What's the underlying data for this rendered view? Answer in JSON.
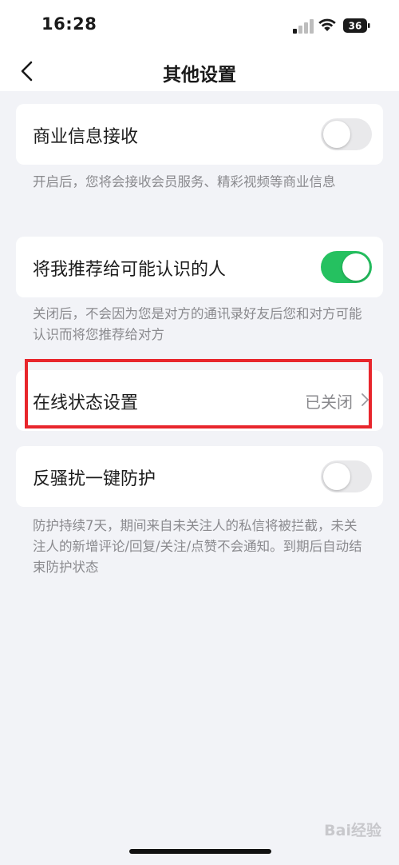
{
  "status_bar": {
    "time": "16:28",
    "battery_level": "36",
    "icons": [
      "signal-icon",
      "wifi-icon",
      "battery-icon"
    ]
  },
  "nav": {
    "title": "其他设置",
    "back_icon": "chevron-left-icon"
  },
  "settings": {
    "business_info": {
      "label": "商业信息接收",
      "enabled": false,
      "description": "开启后，您将会接收会员服务、精彩视频等商业信息"
    },
    "recommend": {
      "label": "将我推荐给可能认识的人",
      "enabled": true,
      "description": "关闭后，不会因为您是对方的通讯录好友后您和对方可能认识而将您推荐给对方"
    },
    "online_status": {
      "label": "在线状态设置",
      "value": "已关闭"
    },
    "anti_harassment": {
      "label": "反骚扰一键防护",
      "enabled": false,
      "description": "防护持续7天，期间来自未关注人的私信将被拦截，未关注人的新增评论/回复/关注/点赞不会通知。到期后自动结束防护状态"
    }
  },
  "colors": {
    "toggle_on": "#25c160",
    "toggle_off": "#e9e9eb",
    "highlight": "#e8262c",
    "background": "#f2f3f7"
  },
  "watermark": "Bai经验"
}
